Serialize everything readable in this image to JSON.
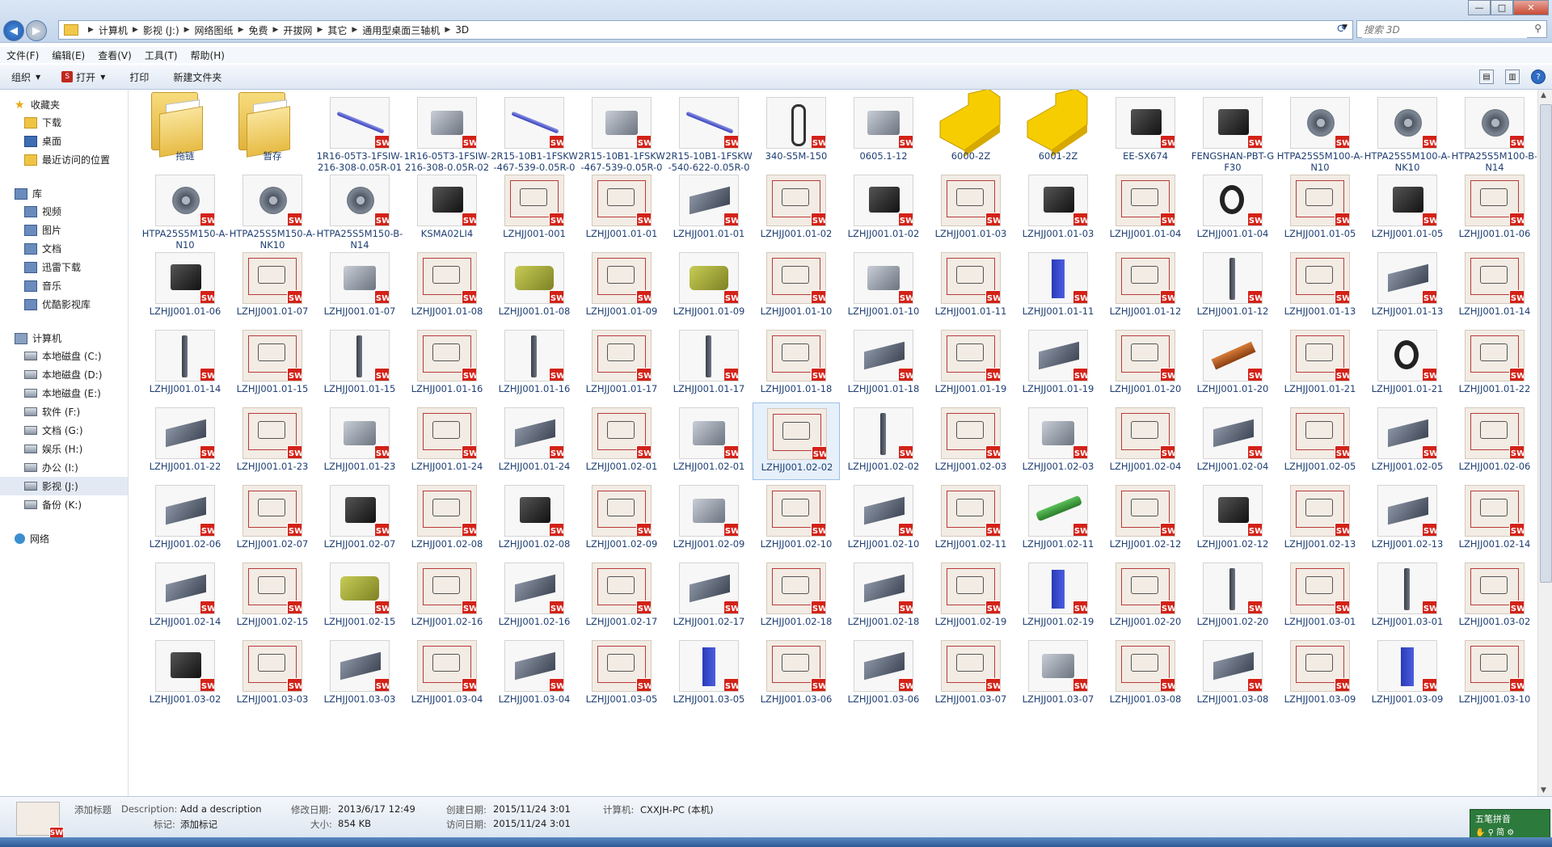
{
  "window": {
    "minimize_label": "—",
    "maximize_label": "□",
    "close_label": "✕"
  },
  "address": {
    "crumbs": [
      "计算机",
      "影视 (J:)",
      "网络图纸",
      "免费",
      "开拔网",
      "其它",
      "通用型桌面三轴机",
      "3D"
    ]
  },
  "search": {
    "placeholder": "搜索 3D"
  },
  "menu": [
    "文件(F)",
    "编辑(E)",
    "查看(V)",
    "工具(T)",
    "帮助(H)"
  ],
  "toolbar": {
    "organize": "组织",
    "open": "打开",
    "print": "打印",
    "new_folder": "新建文件夹"
  },
  "sidebar": {
    "favorites": {
      "label": "收藏夹",
      "items": [
        "下载",
        "桌面",
        "最近访问的位置"
      ]
    },
    "libraries": {
      "label": "库",
      "items": [
        "视频",
        "图片",
        "文档",
        "迅雷下载",
        "音乐",
        "优酷影视库"
      ]
    },
    "computer": {
      "label": "计算机",
      "items": [
        "本地磁盘 (C:)",
        "本地磁盘 (D:)",
        "本地磁盘 (E:)",
        "软件 (F:)",
        "文档 (G:)",
        "娱乐 (H:)",
        "办公 (I:)",
        "影视 (J:)",
        "备份 (K:)"
      ]
    },
    "network": {
      "label": "网络"
    }
  },
  "files": [
    {
      "name": "拖链",
      "kind": "folder"
    },
    {
      "name": "暂存",
      "kind": "folder"
    },
    {
      "name": "1R16-05T3-1FSIW-216-308-0.05R-01",
      "kind": "rod"
    },
    {
      "name": "1R16-05T3-1FSIW-216-308-0.05R-02",
      "kind": "part"
    },
    {
      "name": "2R15-10B1-1FSKW-467-539-0.05R-01",
      "kind": "rod"
    },
    {
      "name": "2R15-10B1-1FSKW-467-539-0.05R-02",
      "kind": "part"
    },
    {
      "name": "2R15-10B1-1FSKW-540-622-0.05R-01",
      "kind": "rod"
    },
    {
      "name": "340-S5M-150",
      "kind": "belt"
    },
    {
      "name": "0605.1-12",
      "kind": "part"
    },
    {
      "name": "6000-2Z",
      "kind": "yellow"
    },
    {
      "name": "6001-2Z",
      "kind": "yellow"
    },
    {
      "name": "EE-SX674",
      "kind": "dark"
    },
    {
      "name": "FENGSHAN-PBT-GF30",
      "kind": "dark"
    },
    {
      "name": "HTPA25S5M100-A-N10",
      "kind": "gear"
    },
    {
      "name": "HTPA25S5M100-A-NK10",
      "kind": "gear"
    },
    {
      "name": "HTPA25S5M100-B-N14",
      "kind": "gear"
    },
    {
      "name": "HTPA25S5M150-A-N10",
      "kind": "gear"
    },
    {
      "name": "HTPA25S5M150-A-NK10",
      "kind": "gear"
    },
    {
      "name": "HTPA25S5M150-B-N14",
      "kind": "gear"
    },
    {
      "name": "KSMA02LI4",
      "kind": "dark"
    },
    {
      "name": "LZHJJ001-001",
      "kind": "drawing"
    },
    {
      "name": "LZHJJ001.01-01",
      "kind": "drawing"
    },
    {
      "name": "LZHJJ001.01-01",
      "kind": "plate"
    },
    {
      "name": "LZHJJ001.01-02",
      "kind": "drawing"
    },
    {
      "name": "LZHJJ001.01-02",
      "kind": "dark"
    },
    {
      "name": "LZHJJ001.01-03",
      "kind": "drawing"
    },
    {
      "name": "LZHJJ001.01-03",
      "kind": "dark"
    },
    {
      "name": "LZHJJ001.01-04",
      "kind": "drawing"
    },
    {
      "name": "LZHJJ001.01-04",
      "kind": "ring"
    },
    {
      "name": "LZHJJ001.01-05",
      "kind": "drawing"
    },
    {
      "name": "LZHJJ001.01-05",
      "kind": "dark"
    },
    {
      "name": "LZHJJ001.01-06",
      "kind": "drawing"
    },
    {
      "name": "LZHJJ001.01-06",
      "kind": "dark"
    },
    {
      "name": "LZHJJ001.01-07",
      "kind": "drawing"
    },
    {
      "name": "LZHJJ001.01-07",
      "kind": "part"
    },
    {
      "name": "LZHJJ001.01-08",
      "kind": "drawing"
    },
    {
      "name": "LZHJJ001.01-08",
      "kind": "olive"
    },
    {
      "name": "LZHJJ001.01-09",
      "kind": "drawing"
    },
    {
      "name": "LZHJJ001.01-09",
      "kind": "olive"
    },
    {
      "name": "LZHJJ001.01-10",
      "kind": "drawing"
    },
    {
      "name": "LZHJJ001.01-10",
      "kind": "part"
    },
    {
      "name": "LZHJJ001.01-11",
      "kind": "drawing"
    },
    {
      "name": "LZHJJ001.01-11",
      "kind": "blue"
    },
    {
      "name": "LZHJJ001.01-12",
      "kind": "drawing"
    },
    {
      "name": "LZHJJ001.01-12",
      "kind": "bar"
    },
    {
      "name": "LZHJJ001.01-13",
      "kind": "drawing"
    },
    {
      "name": "LZHJJ001.01-13",
      "kind": "plate"
    },
    {
      "name": "LZHJJ001.01-14",
      "kind": "drawing"
    },
    {
      "name": "LZHJJ001.01-14",
      "kind": "bar"
    },
    {
      "name": "LZHJJ001.01-15",
      "kind": "drawing"
    },
    {
      "name": "LZHJJ001.01-15",
      "kind": "bar"
    },
    {
      "name": "LZHJJ001.01-16",
      "kind": "drawing"
    },
    {
      "name": "LZHJJ001.01-16",
      "kind": "bar"
    },
    {
      "name": "LZHJJ001.01-17",
      "kind": "drawing"
    },
    {
      "name": "LZHJJ001.01-17",
      "kind": "bar"
    },
    {
      "name": "LZHJJ001.01-18",
      "kind": "drawing"
    },
    {
      "name": "LZHJJ001.01-18",
      "kind": "plate"
    },
    {
      "name": "LZHJJ001.01-19",
      "kind": "drawing"
    },
    {
      "name": "LZHJJ001.01-19",
      "kind": "plate"
    },
    {
      "name": "LZHJJ001.01-20",
      "kind": "drawing"
    },
    {
      "name": "LZHJJ001.01-20",
      "kind": "brown"
    },
    {
      "name": "LZHJJ001.01-21",
      "kind": "drawing"
    },
    {
      "name": "LZHJJ001.01-21",
      "kind": "ring"
    },
    {
      "name": "LZHJJ001.01-22",
      "kind": "drawing"
    },
    {
      "name": "LZHJJ001.01-22",
      "kind": "plate"
    },
    {
      "name": "LZHJJ001.01-23",
      "kind": "drawing"
    },
    {
      "name": "LZHJJ001.01-23",
      "kind": "part"
    },
    {
      "name": "LZHJJ001.01-24",
      "kind": "drawing"
    },
    {
      "name": "LZHJJ001.01-24",
      "kind": "plate"
    },
    {
      "name": "LZHJJ001.02-01",
      "kind": "drawing"
    },
    {
      "name": "LZHJJ001.02-01",
      "kind": "part"
    },
    {
      "name": "LZHJJ001.02-02",
      "kind": "drawing"
    },
    {
      "name": "LZHJJ001.02-02",
      "kind": "bar"
    },
    {
      "name": "LZHJJ001.02-03",
      "kind": "drawing"
    },
    {
      "name": "LZHJJ001.02-03",
      "kind": "part"
    },
    {
      "name": "LZHJJ001.02-04",
      "kind": "drawing"
    },
    {
      "name": "LZHJJ001.02-04",
      "kind": "plate"
    },
    {
      "name": "LZHJJ001.02-05",
      "kind": "drawing"
    },
    {
      "name": "LZHJJ001.02-05",
      "kind": "plate"
    },
    {
      "name": "LZHJJ001.02-06",
      "kind": "drawing"
    },
    {
      "name": "LZHJJ001.02-06",
      "kind": "plate"
    },
    {
      "name": "LZHJJ001.02-07",
      "kind": "drawing"
    },
    {
      "name": "LZHJJ001.02-07",
      "kind": "dark"
    },
    {
      "name": "LZHJJ001.02-08",
      "kind": "drawing"
    },
    {
      "name": "LZHJJ001.02-08",
      "kind": "dark"
    },
    {
      "name": "LZHJJ001.02-09",
      "kind": "drawing"
    },
    {
      "name": "LZHJJ001.02-09",
      "kind": "part"
    },
    {
      "name": "LZHJJ001.02-10",
      "kind": "drawing"
    },
    {
      "name": "LZHJJ001.02-10",
      "kind": "plate"
    },
    {
      "name": "LZHJJ001.02-11",
      "kind": "drawing"
    },
    {
      "name": "LZHJJ001.02-11",
      "kind": "green"
    },
    {
      "name": "LZHJJ001.02-12",
      "kind": "drawing"
    },
    {
      "name": "LZHJJ001.02-12",
      "kind": "dark"
    },
    {
      "name": "LZHJJ001.02-13",
      "kind": "drawing"
    },
    {
      "name": "LZHJJ001.02-13",
      "kind": "plate"
    },
    {
      "name": "LZHJJ001.02-14",
      "kind": "drawing"
    },
    {
      "name": "LZHJJ001.02-14",
      "kind": "plate"
    },
    {
      "name": "LZHJJ001.02-15",
      "kind": "drawing"
    },
    {
      "name": "LZHJJ001.02-15",
      "kind": "olive"
    },
    {
      "name": "LZHJJ001.02-16",
      "kind": "drawing"
    },
    {
      "name": "LZHJJ001.02-16",
      "kind": "plate"
    },
    {
      "name": "LZHJJ001.02-17",
      "kind": "drawing"
    },
    {
      "name": "LZHJJ001.02-17",
      "kind": "plate"
    },
    {
      "name": "LZHJJ001.02-18",
      "kind": "drawing"
    },
    {
      "name": "LZHJJ001.02-18",
      "kind": "plate"
    },
    {
      "name": "LZHJJ001.02-19",
      "kind": "drawing"
    },
    {
      "name": "LZHJJ001.02-19",
      "kind": "blue"
    },
    {
      "name": "LZHJJ001.02-20",
      "kind": "drawing"
    },
    {
      "name": "LZHJJ001.02-20",
      "kind": "bar"
    },
    {
      "name": "LZHJJ001.03-01",
      "kind": "drawing"
    },
    {
      "name": "LZHJJ001.03-01",
      "kind": "bar"
    },
    {
      "name": "LZHJJ001.03-02",
      "kind": "drawing"
    },
    {
      "name": "LZHJJ001.03-02",
      "kind": "dark"
    },
    {
      "name": "LZHJJ001.03-03",
      "kind": "drawing"
    },
    {
      "name": "LZHJJ001.03-03",
      "kind": "plate"
    },
    {
      "name": "LZHJJ001.03-04",
      "kind": "drawing"
    },
    {
      "name": "LZHJJ001.03-04",
      "kind": "plate"
    },
    {
      "name": "LZHJJ001.03-05",
      "kind": "drawing"
    },
    {
      "name": "LZHJJ001.03-05",
      "kind": "blue"
    },
    {
      "name": "LZHJJ001.03-06",
      "kind": "drawing"
    },
    {
      "name": "LZHJJ001.03-06",
      "kind": "plate"
    },
    {
      "name": "LZHJJ001.03-07",
      "kind": "drawing"
    },
    {
      "name": "LZHJJ001.03-07",
      "kind": "part"
    },
    {
      "name": "LZHJJ001.03-08",
      "kind": "drawing"
    },
    {
      "name": "LZHJJ001.03-08",
      "kind": "plate"
    },
    {
      "name": "LZHJJ001.03-09",
      "kind": "drawing"
    },
    {
      "name": "LZHJJ001.03-09",
      "kind": "blue"
    },
    {
      "name": "LZHJJ001.03-10",
      "kind": "drawing"
    }
  ],
  "badge": "SW",
  "details": {
    "add_title": "添加标题",
    "desc_key": "Description:",
    "desc_val": "Add a description",
    "tag_key": "标记:",
    "tag_val": "添加标记",
    "modified_key": "修改日期:",
    "modified_val": "2013/6/17 12:49",
    "size_key": "大小:",
    "size_val": "854 KB",
    "created_key": "创建日期:",
    "created_val": "2015/11/24 3:01",
    "accessed_key": "访问日期:",
    "accessed_val": "2015/11/24 3:01",
    "computer_key": "计算机:",
    "computer_val": "CXXJH-PC (本机)"
  },
  "ime": {
    "title": "五笔拼音"
  },
  "colors": {
    "accent": "#1f3f73",
    "badge": "#d32218",
    "selected": "#e6f0fb"
  }
}
